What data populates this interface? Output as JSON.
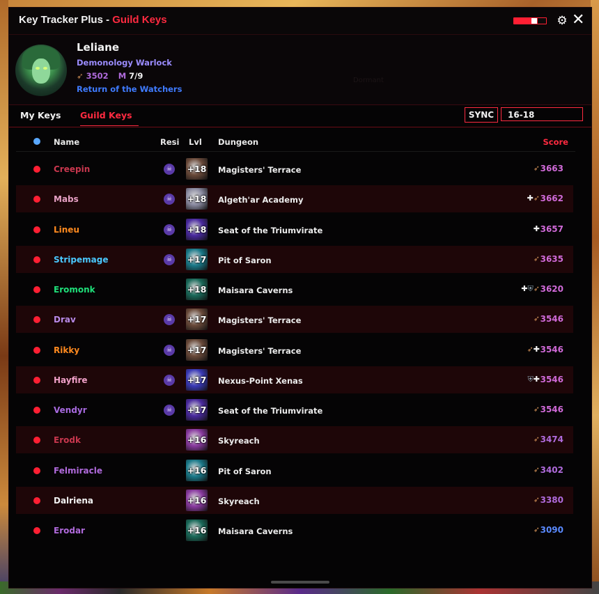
{
  "window": {
    "title_main": "Key Tracker Plus - ",
    "title_accent": "Guild Keys",
    "settings_icon": "gear-icon",
    "close_icon": "close-icon"
  },
  "profile": {
    "name": "Leliane",
    "spec": "Demonology Warlock",
    "score": "3502",
    "m_label": "M",
    "m_value": "7/9",
    "guild": "Return of the Watchers",
    "ghost_text": "Dormant"
  },
  "tabs": [
    {
      "label": "My Keys",
      "active": false
    },
    {
      "label": "Guild Keys",
      "active": true
    }
  ],
  "sync": {
    "label": "SYNC",
    "range_value": "16-18"
  },
  "table": {
    "headers": {
      "name": "Name",
      "resi": "Resi",
      "lvl": "Lvl",
      "dungeon": "Dungeon",
      "score": "Score"
    },
    "rows": [
      {
        "name": "Creepin",
        "color": "#c9374e",
        "resi": true,
        "level": "+18",
        "dungeon": "Magisters' Terrace",
        "icons": [
          "wand"
        ],
        "score": "3663",
        "score_color": "#d06ad8",
        "key_bg": "#6a4a3a"
      },
      {
        "name": "Mabs",
        "color": "#e7a0c4",
        "resi": true,
        "level": "+18",
        "dungeon": "Algeth'ar Academy",
        "icons": [
          "cross",
          "wand"
        ],
        "score": "3662",
        "score_color": "#d06ad8",
        "key_bg": "#8a8aa0"
      },
      {
        "name": "Lineu",
        "color": "#ff8a1f",
        "resi": true,
        "level": "+18",
        "dungeon": "Seat of the Triumvirate",
        "icons": [
          "cross"
        ],
        "score": "3657",
        "score_color": "#d06ad8",
        "key_bg": "#4a2aa0"
      },
      {
        "name": "Stripemage",
        "color": "#4ac8ff",
        "resi": true,
        "level": "+17",
        "dungeon": "Pit of Saron",
        "icons": [
          "wand"
        ],
        "score": "3635",
        "score_color": "#d06ad8",
        "key_bg": "#1a7a8a"
      },
      {
        "name": "Eromonk",
        "color": "#1fe07a",
        "resi": false,
        "level": "+18",
        "dungeon": "Maisara Caverns",
        "icons": [
          "cross",
          "shield",
          "wand"
        ],
        "score": "3620",
        "score_color": "#d06ad8",
        "key_bg": "#1a6a5a"
      },
      {
        "name": "Drav",
        "color": "#b88ae8",
        "resi": true,
        "level": "+17",
        "dungeon": "Magisters' Terrace",
        "icons": [
          "wand"
        ],
        "score": "3546",
        "score_color": "#d06ad8",
        "key_bg": "#6a4a3a"
      },
      {
        "name": "Rikky",
        "color": "#ff8a1f",
        "resi": true,
        "level": "+17",
        "dungeon": "Magisters' Terrace",
        "icons": [
          "wand",
          "cross"
        ],
        "score": "3546",
        "score_color": "#d06ad8",
        "key_bg": "#6a4a3a"
      },
      {
        "name": "Hayfire",
        "color": "#f0a0c8",
        "resi": true,
        "level": "+17",
        "dungeon": "Nexus-Point Xenas",
        "icons": [
          "shield",
          "cross"
        ],
        "score": "3546",
        "score_color": "#d06ad8",
        "key_bg": "#3a3ab8"
      },
      {
        "name": "Vendyr",
        "color": "#a86ae0",
        "resi": true,
        "level": "+17",
        "dungeon": "Seat of the Triumvirate",
        "icons": [
          "wand"
        ],
        "score": "3546",
        "score_color": "#d06ad8",
        "key_bg": "#4a2aa0"
      },
      {
        "name": "Erodk",
        "color": "#c9374e",
        "resi": false,
        "level": "+16",
        "dungeon": "Skyreach",
        "icons": [
          "wand"
        ],
        "score": "3474",
        "score_color": "#b06bdc",
        "key_bg": "#8a3aa0"
      },
      {
        "name": "Felmiracle",
        "color": "#b06adc",
        "resi": false,
        "level": "+16",
        "dungeon": "Pit of Saron",
        "icons": [
          "wand"
        ],
        "score": "3402",
        "score_color": "#b06bdc",
        "key_bg": "#1a7a8a"
      },
      {
        "name": "Dalriena",
        "color": "#f2f2f2",
        "resi": false,
        "level": "+16",
        "dungeon": "Skyreach",
        "icons": [
          "wand"
        ],
        "score": "3380",
        "score_color": "#b06bdc",
        "key_bg": "#8a3aa0"
      },
      {
        "name": "Erodar",
        "color": "#b06adc",
        "resi": false,
        "level": "+16",
        "dungeon": "Maisara Caverns",
        "icons": [
          "wand"
        ],
        "score": "3090",
        "score_color": "#5a8aff",
        "key_bg": "#1a6a5a"
      }
    ]
  },
  "colors": {
    "accent": "#ff2a40",
    "row_alt": "#1e0608",
    "background": "#050405"
  }
}
